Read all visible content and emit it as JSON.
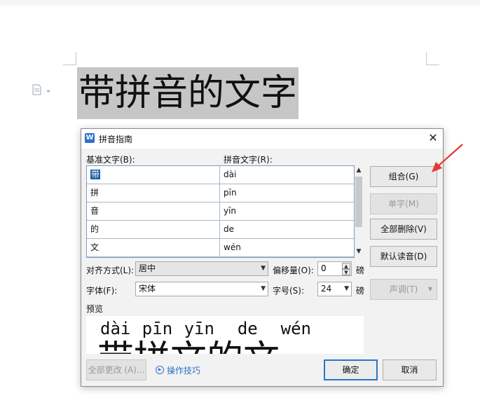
{
  "document": {
    "text": "带拼音的文字"
  },
  "dialog": {
    "title": "拼音指南",
    "app_icon": "W",
    "close_symbol": "✕",
    "base_text_label": "基准文字(B):",
    "pinyin_text_label": "拼音文字(R):",
    "rows": [
      {
        "base": "带",
        "pinyin": "dài"
      },
      {
        "base": "拼",
        "pinyin": "pīn"
      },
      {
        "base": "音",
        "pinyin": "yīn"
      },
      {
        "base": "的",
        "pinyin": "de"
      },
      {
        "base": "文",
        "pinyin": "wén"
      }
    ],
    "alignment": {
      "label": "对齐方式(L):",
      "value": "居中"
    },
    "offset": {
      "label": "偏移量(O):",
      "value": "0",
      "unit": "磅"
    },
    "font": {
      "label": "字体(F):",
      "value": "宋体"
    },
    "font_size": {
      "label": "字号(S):",
      "value": "24",
      "unit": "磅"
    },
    "preview_label": "预览",
    "preview_pinyin": "dài pīn yīn  de  wén",
    "preview_hanzi": "带拼文的文",
    "buttons": {
      "group": "组合(G)",
      "single": "单字(M)",
      "delete_all": "全部删除(V)",
      "default_reading": "默认读音(D)",
      "tone": "声调(T)",
      "change_all": "全部更改 (A)...",
      "tips": "操作技巧",
      "ok": "确定",
      "cancel": "取消"
    }
  },
  "colors": {
    "accent": "#2b74c7",
    "annotation_arrow": "#e53935",
    "selection_highlight": "#c6c6c6"
  }
}
